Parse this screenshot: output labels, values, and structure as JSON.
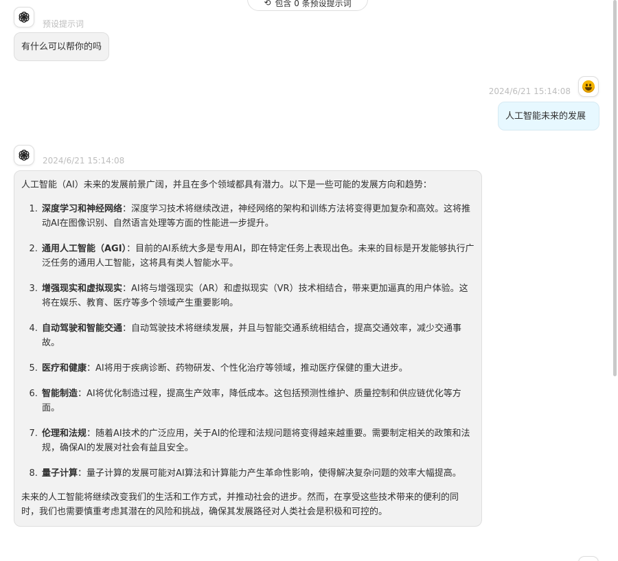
{
  "top_pill": {
    "label": "包含 0 条预设提示词"
  },
  "messages": [
    {
      "role": "assistant",
      "meta": "预设提示词",
      "text": "有什么可以帮你的吗"
    },
    {
      "role": "user",
      "meta": "2024/6/21 15:14:08",
      "text": "人工智能未来的发展"
    },
    {
      "role": "assistant",
      "meta": "2024/6/21 15:14:08",
      "intro": "人工智能（AI）未来的发展前景广阔，并且在多个领域都具有潜力。以下是一些可能的发展方向和趋势：",
      "items": [
        {
          "title": "深度学习和神经网络",
          "text": "：深度学习技术将继续改进，神经网络的架构和训练方法将变得更加复杂和高效。这将推动AI在图像识别、自然语言处理等方面的性能进一步提升。"
        },
        {
          "title": "通用人工智能（AGI）",
          "text": "：目前的AI系统大多是专用AI，即在特定任务上表现出色。未来的目标是开发能够执行广泛任务的通用人工智能，这将具有类人智能水平。"
        },
        {
          "title": "增强现实和虚拟现实",
          "text": "：AI将与增强现实（AR）和虚拟现实（VR）技术相结合，带来更加逼真的用户体验。这将在娱乐、教育、医疗等多个领域产生重要影响。"
        },
        {
          "title": "自动驾驶和智能交通",
          "text": "：自动驾驶技术将继续发展，并且与智能交通系统相结合，提高交通效率，减少交通事故。"
        },
        {
          "title": "医疗和健康",
          "text": "：AI将用于疾病诊断、药物研发、个性化治疗等领域，推动医疗保健的重大进步。"
        },
        {
          "title": "智能制造",
          "text": "：AI将优化制造过程，提高生产效率，降低成本。这包括预测性维护、质量控制和供应链优化等方面。"
        },
        {
          "title": "伦理和法规",
          "text": "：随着AI技术的广泛应用，关于AI的伦理和法规问题将变得越来越重要。需要制定相关的政策和法规，确保AI的发展对社会有益且安全。"
        },
        {
          "title": "量子计算",
          "text": "：量子计算的发展可能对AI算法和计算能力产生革命性影响，使得解决复杂问题的效率大幅提高。"
        }
      ],
      "outro": "未来的人工智能将继续改变我们的生活和工作方式，并推动社会的进步。然而，在享受这些技术带来的便利的同时，我们也需要慎重考虑其潜在的风险和挑战，确保其发展路径对人类社会是积极和可控的。"
    }
  ],
  "icons": {
    "assistant_avatar": "openai-logo-icon",
    "user_avatar": "smiley-emoji-icon",
    "pill_icon": "refresh-icon"
  },
  "colors": {
    "assistant_bubble": "#f2f2f2",
    "user_bubble": "#e7f8ff",
    "meta_text": "#bdbdbd",
    "body_text": "#303030"
  }
}
